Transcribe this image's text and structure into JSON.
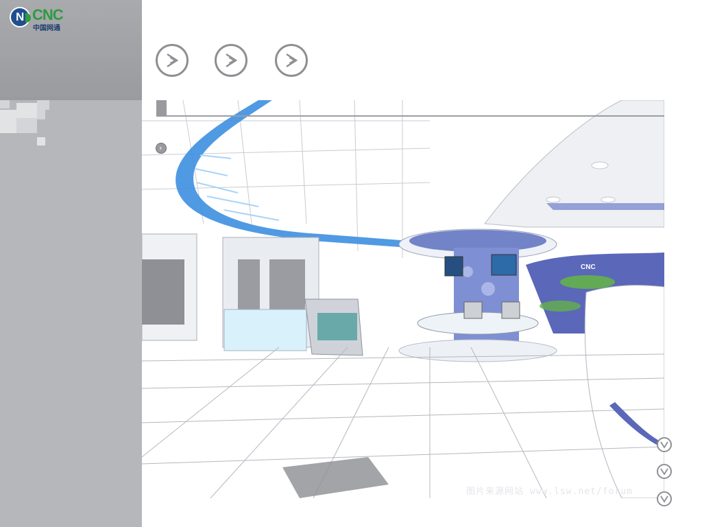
{
  "logo": {
    "text": "CNC",
    "subtitle": "中国网通",
    "icon": "cnc-logo-icon",
    "colors": {
      "green": "#2d9b41",
      "blue": "#1f4f8f"
    }
  },
  "nav": {
    "buttons": [
      {
        "icon": "chevron-right-icon"
      },
      {
        "icon": "chevron-right-icon"
      },
      {
        "icon": "chevron-right-icon"
      }
    ]
  },
  "scene": {
    "description_icon": "exhibition-hall-rendering",
    "accent_blue": "#3d8fe0",
    "sign_text": "CNC"
  },
  "small_marker": {
    "icon": "play-marker-icon",
    "glyph": "›"
  },
  "down_buttons": [
    {
      "icon": "chevron-down-icon"
    },
    {
      "icon": "chevron-down-icon"
    },
    {
      "icon": "chevron-down-icon"
    }
  ],
  "watermark": {
    "text": "图片来源网站  www.lsw.net/forum"
  },
  "colors": {
    "sidebar_top": "#9a9b9f",
    "sidebar_bottom": "#b6b7bb",
    "frame": "#999a9e"
  }
}
